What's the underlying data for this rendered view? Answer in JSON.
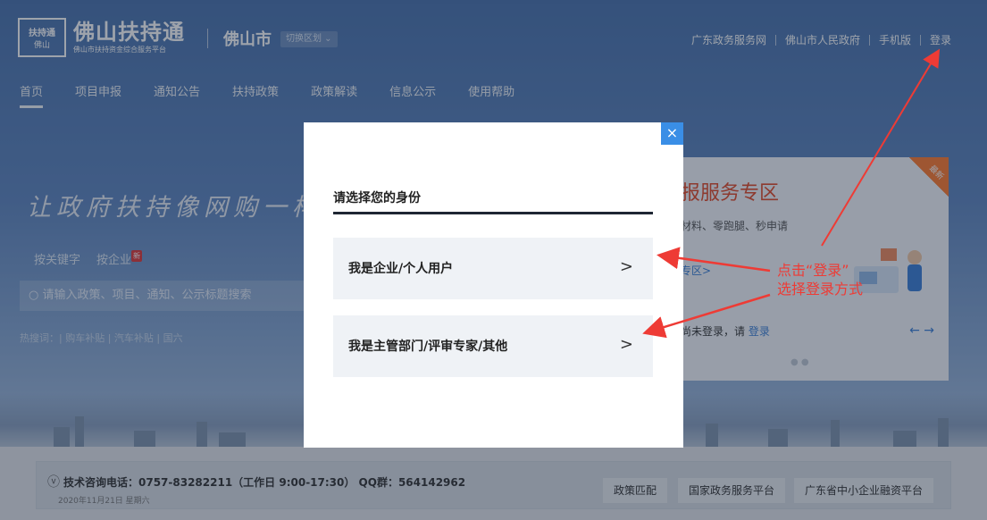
{
  "header": {
    "logo_badge_top": "扶持通",
    "logo_badge_bottom": "佛山",
    "logo_title": "佛山扶持通",
    "logo_subtitle": "佛山市扶持资金综合服务平台",
    "city": "佛山市",
    "city_switch": "切换区划 ⌄",
    "top_links": [
      "广东政务服务网",
      "佛山市人民政府",
      "手机版",
      "登录"
    ]
  },
  "nav": {
    "items": [
      "首页",
      "项目申报",
      "通知公告",
      "扶持政策",
      "政策解读",
      "信息公示",
      "使用帮助"
    ]
  },
  "hero": {
    "slogan": "让政府扶持像网购一样",
    "search_tabs": [
      "按关键字",
      "按企业"
    ],
    "new_badge": "新",
    "search_placeholder": "请输入政策、项目、通知、公示标题搜索",
    "hot_words": "热搜词：| 购车补贴 | 汽车补贴 | 国六"
  },
  "card": {
    "corner": "最新",
    "title": "报服务专区",
    "subtitle": "材料、零跑腿、秒申请",
    "link": "专区>",
    "login_prefix": "尚未登录，请",
    "login_link": "登录",
    "arrows": "←  →",
    "dots": "● ●"
  },
  "info_bar": {
    "text": "技术咨询电话：0757-83282211（工作日 9:00-17:30） QQ群：564142962",
    "date": "2020年11月21日  星期六",
    "buttons": [
      "政策匹配",
      "国家政务服务平台",
      "广东省中小企业融资平台"
    ]
  },
  "modal": {
    "close": "×",
    "title": "请选择您的身份",
    "options": [
      {
        "label": "我是企业/个人用户",
        "chevron": ">"
      },
      {
        "label": "我是主管部门/评审专家/其他",
        "chevron": ">"
      }
    ]
  },
  "annotation": {
    "line1": "点击“登录”",
    "line2": "选择登录方式"
  },
  "colors": {
    "accent": "#3a8ee6",
    "annotation": "#ee3b35",
    "hero": "#5f86bf"
  }
}
